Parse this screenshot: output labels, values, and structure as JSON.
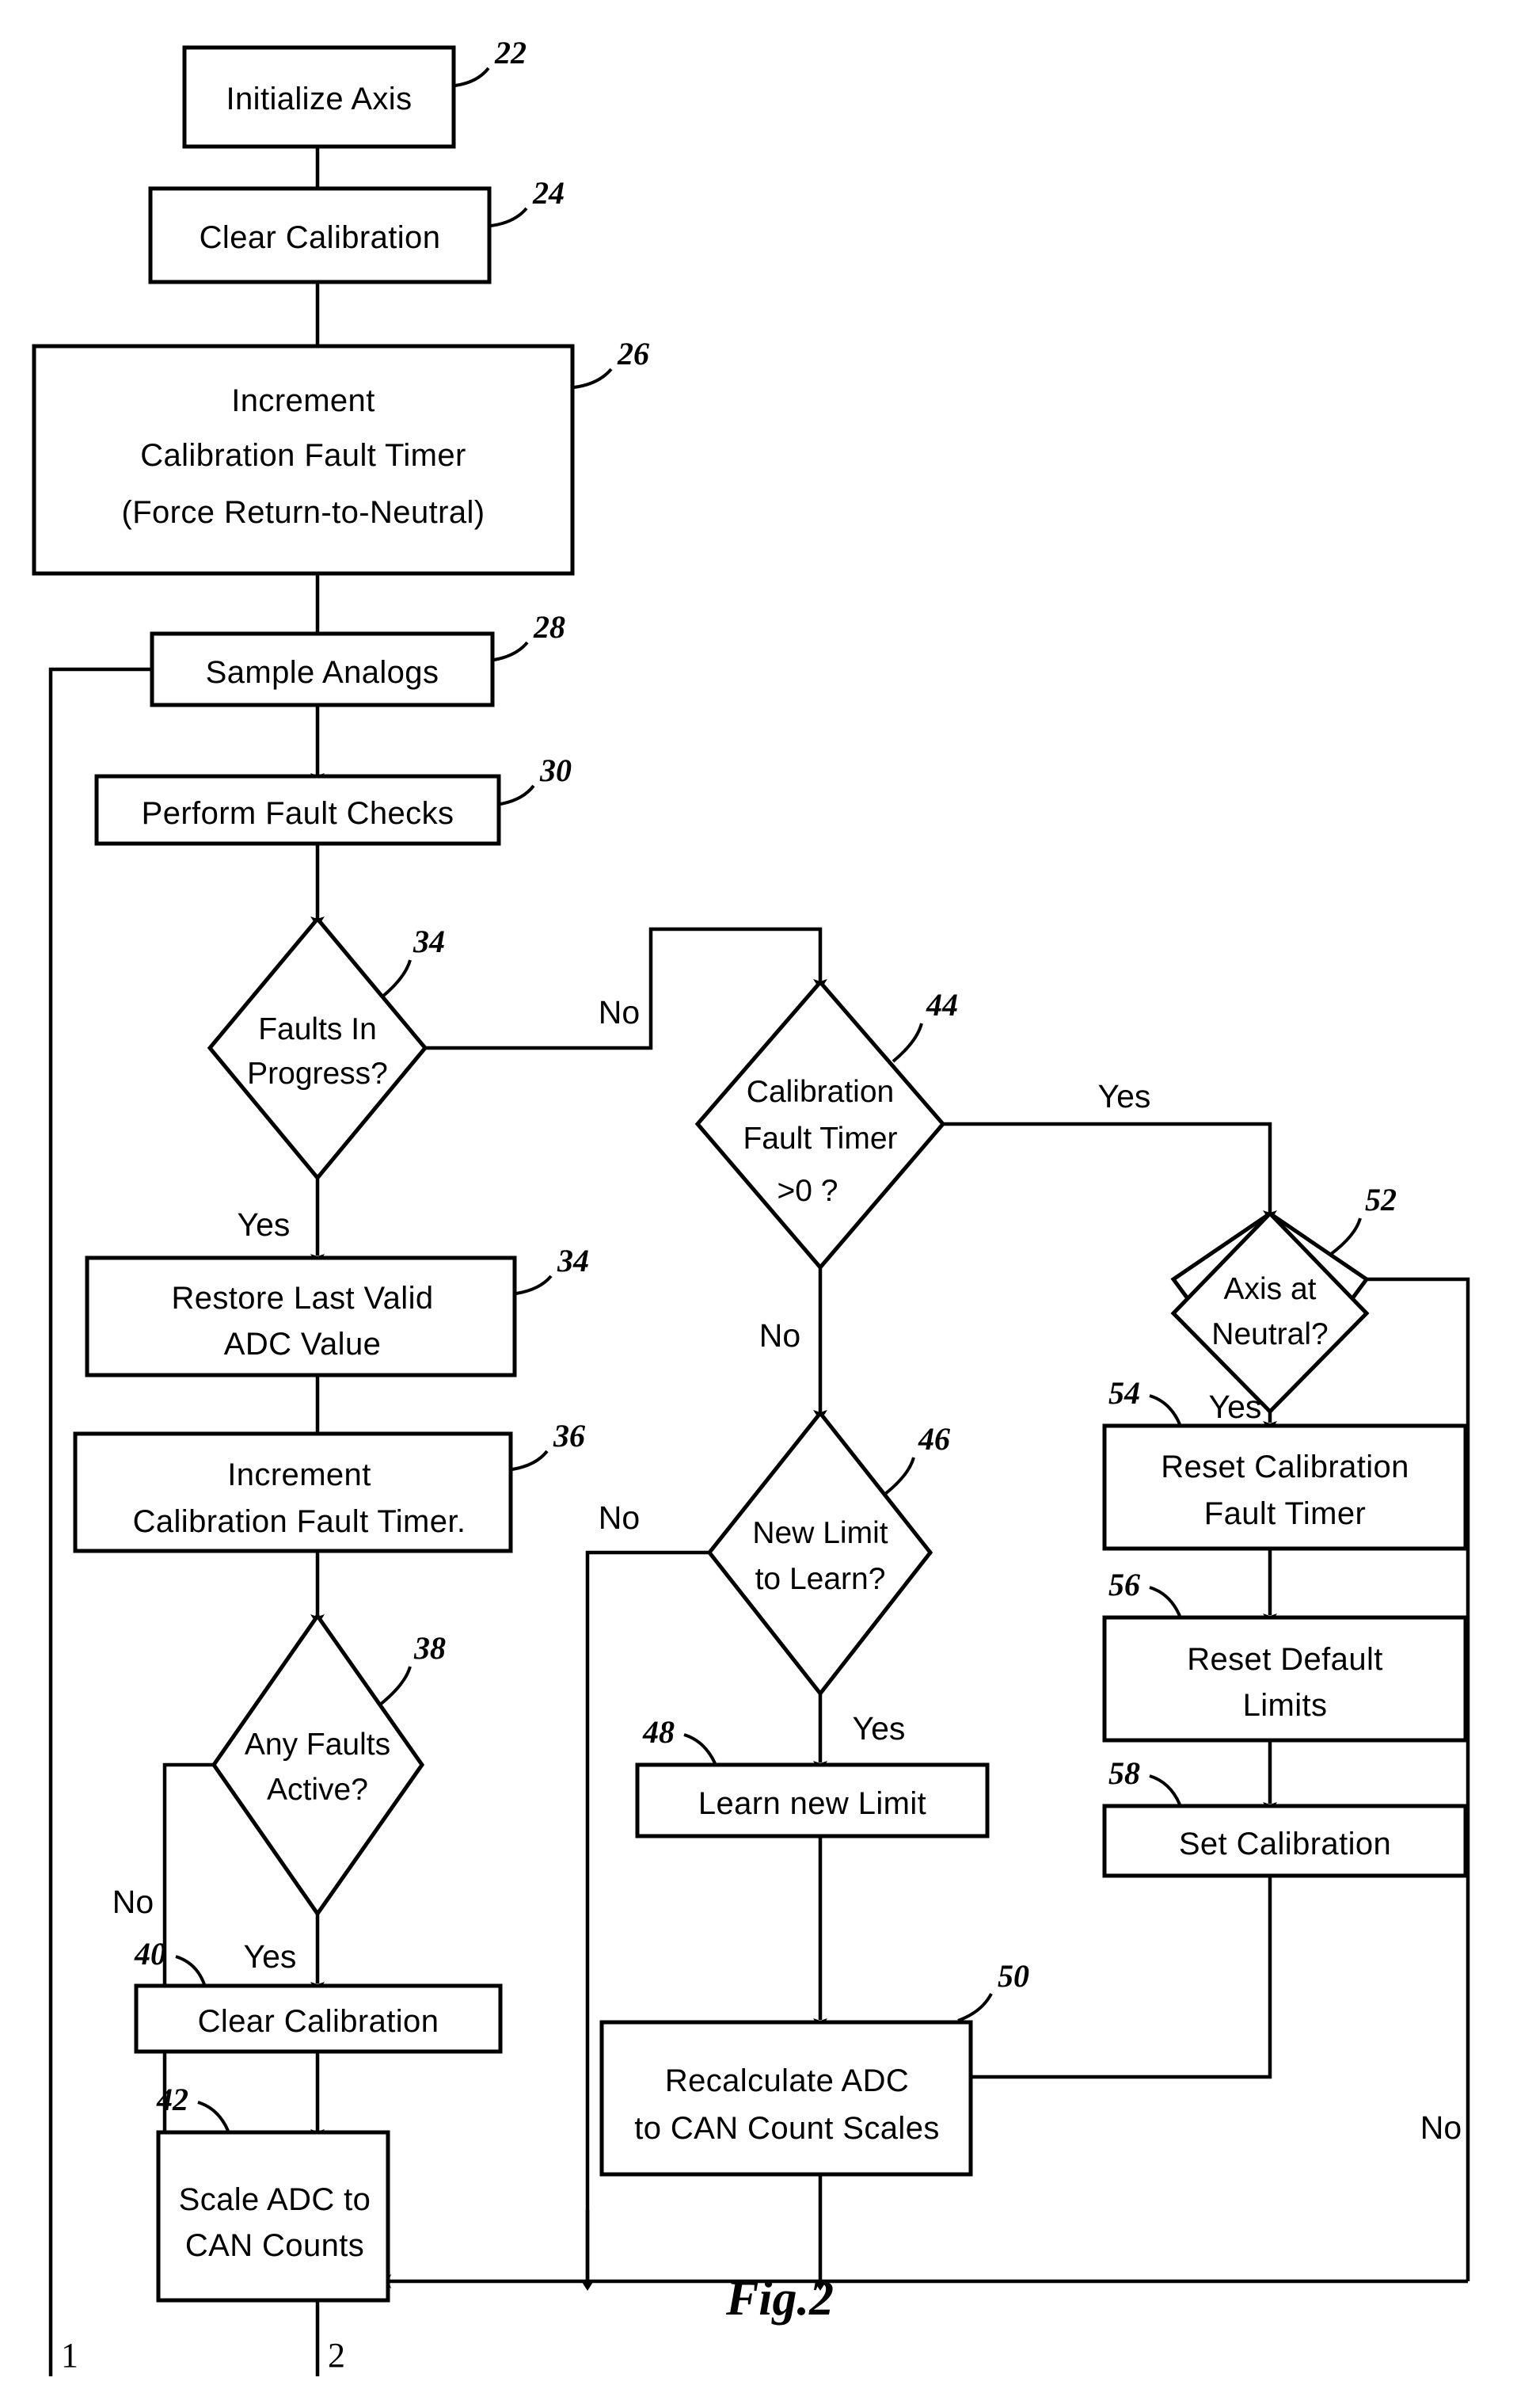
{
  "figure": {
    "label": "Fig.2",
    "title": "Axis calibration and fault handling flowchart"
  },
  "nodes": [
    {
      "id": "n22",
      "ref": "22",
      "type": "process",
      "lines": [
        "Initialize Axis"
      ]
    },
    {
      "id": "n24",
      "ref": "24",
      "type": "process",
      "lines": [
        "Clear Calibration"
      ]
    },
    {
      "id": "n26",
      "ref": "26",
      "type": "process",
      "lines": [
        "Increment",
        "Calibration Fault Timer",
        "(Force Return-to-Neutral)"
      ]
    },
    {
      "id": "n28",
      "ref": "28",
      "type": "process",
      "lines": [
        "Sample Analogs"
      ]
    },
    {
      "id": "n30",
      "ref": "30",
      "type": "process",
      "lines": [
        "Perform Fault Checks"
      ]
    },
    {
      "id": "n32",
      "ref": "34",
      "type": "decision",
      "lines": [
        "Faults In",
        "Progress?"
      ]
    },
    {
      "id": "n34",
      "ref": "34",
      "type": "process",
      "lines": [
        "Restore Last Valid",
        "ADC Value"
      ]
    },
    {
      "id": "n36",
      "ref": "36",
      "type": "process",
      "lines": [
        "Increment",
        "Calibration Fault Timer."
      ]
    },
    {
      "id": "n38",
      "ref": "38",
      "type": "decision",
      "lines": [
        "Any Faults",
        "Active?"
      ]
    },
    {
      "id": "n40",
      "ref": "40",
      "type": "process",
      "lines": [
        "Clear Calibration"
      ]
    },
    {
      "id": "n42",
      "ref": "42",
      "type": "process",
      "lines": [
        "Scale ADC to",
        "CAN Counts"
      ]
    },
    {
      "id": "n44",
      "ref": "44",
      "type": "decision",
      "lines": [
        "Calibration",
        "Fault Timer",
        ">0  ?"
      ]
    },
    {
      "id": "n46",
      "ref": "46",
      "type": "decision",
      "lines": [
        "New Limit",
        "to Learn?"
      ]
    },
    {
      "id": "n48",
      "ref": "48",
      "type": "process",
      "lines": [
        "Learn new Limit"
      ]
    },
    {
      "id": "n50",
      "ref": "50",
      "type": "process",
      "lines": [
        "Recalculate ADC",
        "to CAN Count Scales"
      ]
    },
    {
      "id": "n52",
      "ref": "52",
      "type": "decision",
      "lines": [
        "Axis at",
        "Neutral?"
      ]
    },
    {
      "id": "n54",
      "ref": "54",
      "type": "process",
      "lines": [
        "Reset Calibration",
        "Fault Timer"
      ]
    },
    {
      "id": "n56",
      "ref": "56",
      "type": "process",
      "lines": [
        "Reset Default",
        "Limits"
      ]
    },
    {
      "id": "n58",
      "ref": "58",
      "type": "process",
      "lines": [
        "Set Calibration"
      ]
    }
  ],
  "edge_labels": {
    "faults_in_progress_no": "No",
    "faults_in_progress_yes": "Yes",
    "any_faults_active_no": "No",
    "any_faults_active_yes": "Yes",
    "cal_fault_timer_yes": "Yes",
    "cal_fault_timer_no": "No",
    "new_limit_no": "No",
    "new_limit_yes": "Yes",
    "axis_neutral_yes": "Yes",
    "axis_neutral_no": "No"
  },
  "connectors": [
    {
      "id": "c1",
      "label": "1"
    },
    {
      "id": "c2",
      "label": "2"
    }
  ]
}
